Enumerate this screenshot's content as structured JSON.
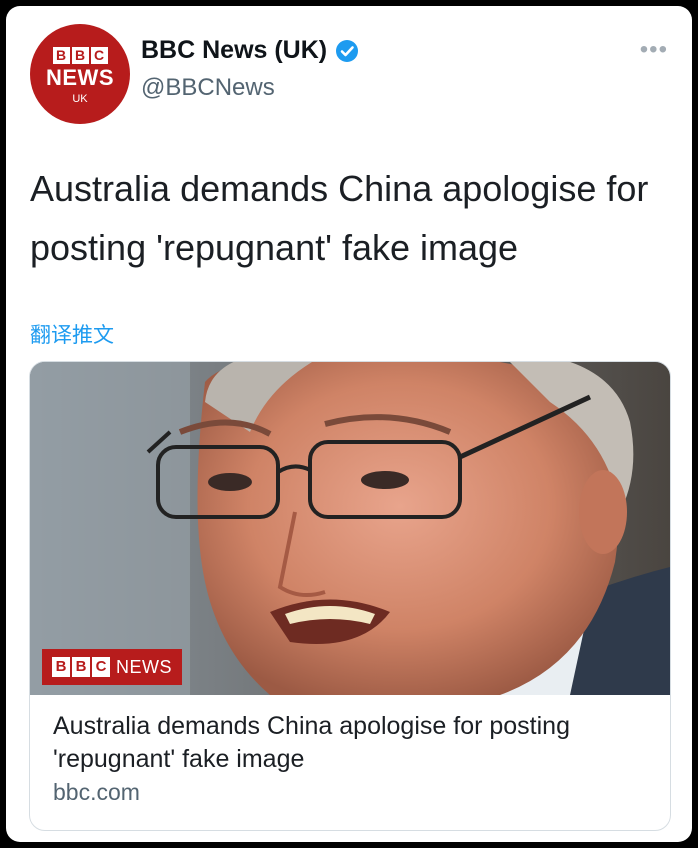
{
  "account": {
    "avatar_blocks": [
      "B",
      "B",
      "C"
    ],
    "avatar_news": "NEWS",
    "avatar_uk": "UK",
    "display_name": "BBC News (UK)",
    "handle": "@BBCNews",
    "verified": true
  },
  "menu": {
    "more_label": "•••"
  },
  "tweet": {
    "text": "Australia demands China apologise for posting 'repugnant' fake image",
    "translate_label": "翻译推文"
  },
  "link_card": {
    "badge_blocks": [
      "B",
      "B",
      "C"
    ],
    "badge_label": "NEWS",
    "title": "Australia demands China apologise for posting 'repugnant' fake image",
    "domain": "bbc.com"
  },
  "colors": {
    "brand_red": "#b71c1c",
    "link_blue": "#1d9bf0",
    "verified_blue": "#1d9bf0"
  }
}
